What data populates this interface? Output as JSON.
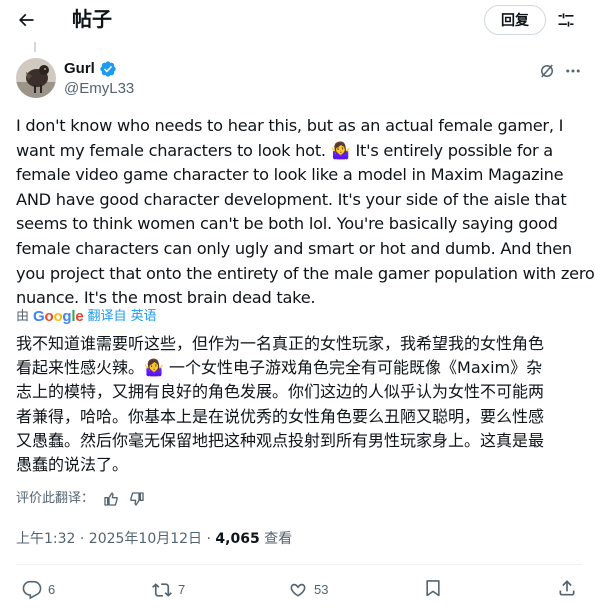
{
  "header": {
    "title": "帖子",
    "back_icon": "arrow-left-icon",
    "reply_label": "回复",
    "settings_icon": "sliders-icon"
  },
  "post": {
    "author": {
      "display_name": "Gurl",
      "handle": "@EmyL33",
      "verified": true,
      "verified_color": "#1d9bf0"
    },
    "text_lines": [
      "I don't know who needs to hear this, but as an actual female gamer, I",
      "want my female characters to look hot. 🤷‍♀️ It's entirely possible for a",
      "female video game character to look like a model in Maxim Magazine",
      "AND have good character development. It's your side of the aisle that",
      "seems to think women can't be both lol. You're basically saying good",
      "female characters can only ugly and smart or hot and dumb. And then",
      "you project that onto the entirety of the male gamer population with zero",
      "nuance. It's the most brain dead take."
    ],
    "translation": {
      "by_prefix": "由",
      "google": "Google",
      "link_label": "翻译自 英语",
      "lines": [
        "我不知道谁需要听这些，但作为一名真正的女性玩家，我希望我的女性角色",
        "看起来性感火辣。🤷‍♀️ 一个女性电子游戏角色完全有可能既像《Maxim》杂",
        "志上的模特，又拥有良好的角色发展。你们这边的人似乎认为女性不可能两",
        "者兼得，哈哈。你基本上是在说优秀的女性角色要么丑陋又聪明，要么性感",
        "又愚蠢。然后你毫无保留地把这种观点投射到所有男性玩家身上。这真是最",
        "愚蠢的说法了。"
      ],
      "rate_label": "评价此翻译："
    },
    "timestamp": "上午1:32 · 2025年10月12日 · ",
    "views_count": "4,065",
    "views_label": " 查看",
    "actions": {
      "replies": "6",
      "reposts": "7",
      "likes": "53"
    }
  }
}
